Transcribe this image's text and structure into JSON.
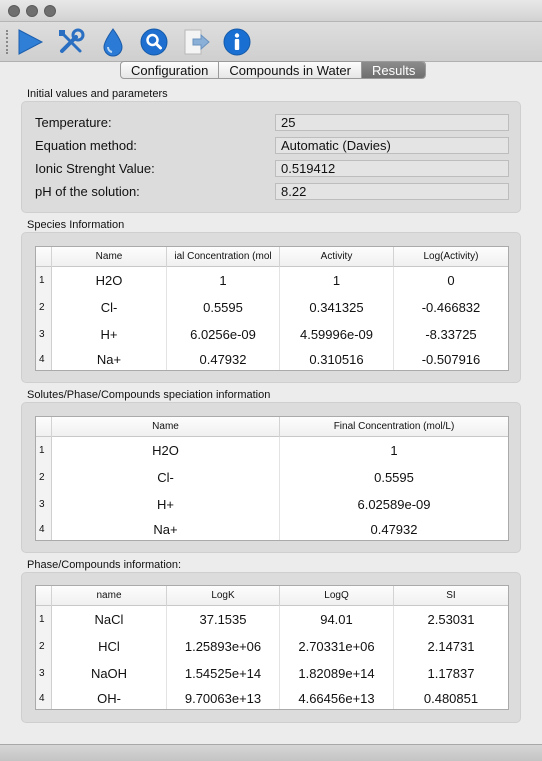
{
  "toolbar": {
    "buttons": [
      {
        "name": "run-icon",
        "color": "#2f7fd6"
      },
      {
        "name": "tools-icon",
        "color": "#2a6fc2"
      },
      {
        "name": "water-drop-icon",
        "color": "#2a7ad6"
      },
      {
        "name": "search-icon",
        "color": "#1e6fd0"
      },
      {
        "name": "export-icon",
        "color": "#8ab0d8"
      },
      {
        "name": "info-icon",
        "color": "#1a6fd3"
      }
    ]
  },
  "tabs": [
    {
      "label": "Configuration",
      "selected": false
    },
    {
      "label": "Compounds in Water",
      "selected": false
    },
    {
      "label": "Results",
      "selected": true
    }
  ],
  "initial": {
    "title": "Initial values and parameters",
    "rows": [
      {
        "label": "Temperature:",
        "value": "25"
      },
      {
        "label": "Equation method:",
        "value": "Automatic (Davies)"
      },
      {
        "label": "Ionic Strenght Value:",
        "value": "0.519412"
      },
      {
        "label": "pH of the solution:",
        "value": "8.22"
      }
    ]
  },
  "species": {
    "title": "Species Information",
    "headers": [
      "Name",
      "ial Concentration (mol",
      "Activity",
      "Log(Activity)"
    ],
    "rows": [
      [
        "1",
        "H2O",
        "1",
        "1",
        "0"
      ],
      [
        "2",
        "Cl-",
        "0.5595",
        "0.341325",
        "-0.466832"
      ],
      [
        "3",
        "H+",
        "6.0256e-09",
        "4.59996e-09",
        "-8.33725"
      ],
      [
        "4",
        "Na+",
        "0.47932",
        "0.310516",
        "-0.507916"
      ]
    ]
  },
  "solutes": {
    "title": "Solutes/Phase/Compounds speciation information",
    "headers": [
      "Name",
      "Final Concentration (mol/L)"
    ],
    "rows": [
      [
        "1",
        "H2O",
        "1"
      ],
      [
        "2",
        "Cl-",
        "0.5595"
      ],
      [
        "3",
        "H+",
        "6.02589e-09"
      ],
      [
        "4",
        "Na+",
        "0.47932"
      ]
    ]
  },
  "phase": {
    "title": "Phase/Compounds information:",
    "headers": [
      "name",
      "LogK",
      "LogQ",
      "SI"
    ],
    "rows": [
      [
        "1",
        "NaCl",
        "37.1535",
        "94.01",
        "2.53031"
      ],
      [
        "2",
        "HCl",
        "1.25893e+06",
        "2.70331e+06",
        "2.14731"
      ],
      [
        "3",
        "NaOH",
        "1.54525e+14",
        "1.82089e+14",
        "1.17837"
      ],
      [
        "4",
        "OH-",
        "9.70063e+13",
        "4.66456e+13",
        "0.480851"
      ]
    ]
  }
}
